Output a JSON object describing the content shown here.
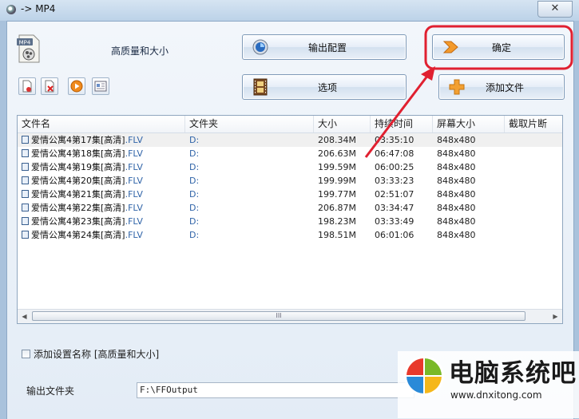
{
  "window": {
    "title": "-> MP4",
    "close_glyph": "✕"
  },
  "preset": {
    "label": "高质量和大小"
  },
  "buttons": {
    "output_config": "输出配置",
    "ok": "确定",
    "options": "选项",
    "add_file": "添加文件"
  },
  "toolbar_icons": [
    "remove-file-icon",
    "clear-list-icon",
    "play-icon",
    "file-info-icon"
  ],
  "columns": [
    "文件名",
    "文件夹",
    "大小",
    "持续时间",
    "屏幕大小",
    "截取片断"
  ],
  "files": [
    {
      "name": "爱情公寓4第17集[高清]",
      "ext": ".FLV",
      "folder": "D:",
      "size": "208.34M",
      "duration": "03:35:10",
      "screen": "848x480"
    },
    {
      "name": "爱情公寓4第18集[高清]",
      "ext": ".FLV",
      "folder": "D:",
      "size": "206.63M",
      "duration": "06:47:08",
      "screen": "848x480"
    },
    {
      "name": "爱情公寓4第19集[高清]",
      "ext": ".FLV",
      "folder": "D:",
      "size": "199.59M",
      "duration": "06:00:25",
      "screen": "848x480"
    },
    {
      "name": "爱情公寓4第20集[高清]",
      "ext": ".FLV",
      "folder": "D:",
      "size": "199.99M",
      "duration": "03:33:23",
      "screen": "848x480"
    },
    {
      "name": "爱情公寓4第21集[高清]",
      "ext": ".FLV",
      "folder": "D:",
      "size": "199.77M",
      "duration": "02:51:07",
      "screen": "848x480"
    },
    {
      "name": "爱情公寓4第22集[高清]",
      "ext": ".FLV",
      "folder": "D:",
      "size": "206.87M",
      "duration": "03:34:47",
      "screen": "848x480"
    },
    {
      "name": "爱情公寓4第23集[高清]",
      "ext": ".FLV",
      "folder": "D:",
      "size": "198.23M",
      "duration": "03:33:49",
      "screen": "848x480"
    },
    {
      "name": "爱情公寓4第24集[高清]",
      "ext": ".FLV",
      "folder": "D:",
      "size": "198.51M",
      "duration": "06:01:06",
      "screen": "848x480"
    }
  ],
  "scrollbar": {
    "left_arrow": "◀",
    "right_arrow": "▶",
    "grip": "III"
  },
  "append_setting": {
    "label": "添加设置名称 [高质量和大小]",
    "checked": false
  },
  "output": {
    "label": "输出文件夹",
    "value": "F:\\FFOutput"
  },
  "watermark": {
    "brand": "电脑系统吧",
    "url": "www.dnxitong.com"
  },
  "colors": {
    "annotation": "#e02030",
    "accent": "#3064a8"
  }
}
